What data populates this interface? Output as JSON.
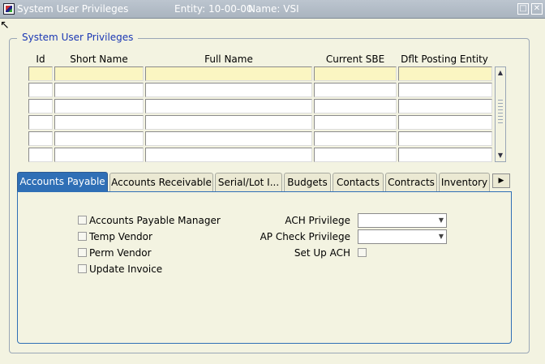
{
  "window": {
    "title": "System User Privileges",
    "entity": "Entity: 10-00-00",
    "name": "Name: VSI"
  },
  "frame": {
    "title": "System User Privileges"
  },
  "grid": {
    "columns": [
      "Id",
      "Short Name",
      "Full Name",
      "Current SBE",
      "Dflt Posting Entity"
    ],
    "row_count": 6
  },
  "tabs": [
    {
      "label": "Accounts Payable",
      "active": true
    },
    {
      "label": "Accounts Receivable"
    },
    {
      "label": "Serial/Lot I..."
    },
    {
      "label": "Budgets"
    },
    {
      "label": "Contacts"
    },
    {
      "label": "Contracts"
    },
    {
      "label": "Inventory"
    }
  ],
  "ap": {
    "checkboxes": [
      {
        "label": "Accounts Payable Manager",
        "checked": false
      },
      {
        "label": "Temp Vendor",
        "checked": false
      },
      {
        "label": "Perm Vendor",
        "checked": false
      },
      {
        "label": "Update Invoice",
        "checked": false
      }
    ],
    "ach_privilege": {
      "label": "ACH Privilege",
      "value": ""
    },
    "ap_check_privilege": {
      "label": "AP Check Privilege",
      "value": ""
    },
    "set_up_ach": {
      "label": "Set Up ACH",
      "checked": false
    }
  },
  "colors": {
    "title_text": "#1a37b4",
    "active_tab": "#2f6fb6",
    "active_row": "#fbf6c2",
    "background": "#f3f3e1"
  },
  "icons": [
    "app-icon",
    "cursor-pointer-icon",
    "maximize-icon",
    "close-icon",
    "scroll-up-icon",
    "scroll-down-icon",
    "tab-scroll-right-icon",
    "dropdown-arrow-icon"
  ]
}
